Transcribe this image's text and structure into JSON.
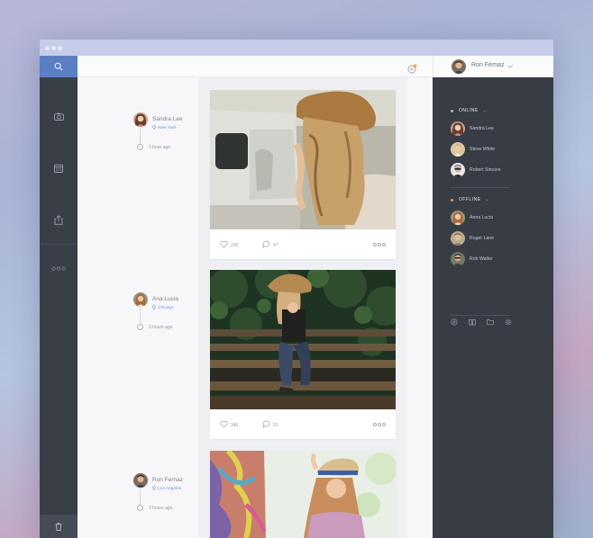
{
  "user": {
    "name": "Ron Fernaz"
  },
  "timeline": [
    {
      "name": "Sandra Lee",
      "location": "New York",
      "time": "1 hour ago"
    },
    {
      "name": "Ana Lucia",
      "location": "Chicago",
      "time": "2 hours ago"
    },
    {
      "name": "Ron Fernaz",
      "location": "Los Angeles",
      "time": "3 hours ago"
    }
  ],
  "posts": [
    {
      "likes": "235",
      "comments": "47"
    },
    {
      "likes": "346",
      "comments": "53"
    }
  ],
  "contacts": {
    "online_label": "ONLINE",
    "online": [
      "Sandra Lee",
      "Steve White",
      "Robert Sincere"
    ],
    "offline_label": "OFFLINE",
    "offline": [
      "Anna Lucia",
      "Roger Lane",
      "Rob Walter"
    ]
  },
  "icons": {
    "left_sidebar": [
      "search-icon",
      "camera-icon",
      "calendar-icon",
      "share-icon",
      "more-icon",
      "trash-icon"
    ],
    "topbar": [
      "notification-icon",
      "chevron-down-icon"
    ],
    "right_panel_bottom": [
      "add-icon",
      "book-icon",
      "folder-icon",
      "settings-icon"
    ]
  },
  "colors": {
    "accent": "#5b7ec5",
    "dark_panel": "#3a3e47",
    "online": "#8fd19e",
    "offline": "#e39b6a",
    "location": "#6e95d6"
  }
}
